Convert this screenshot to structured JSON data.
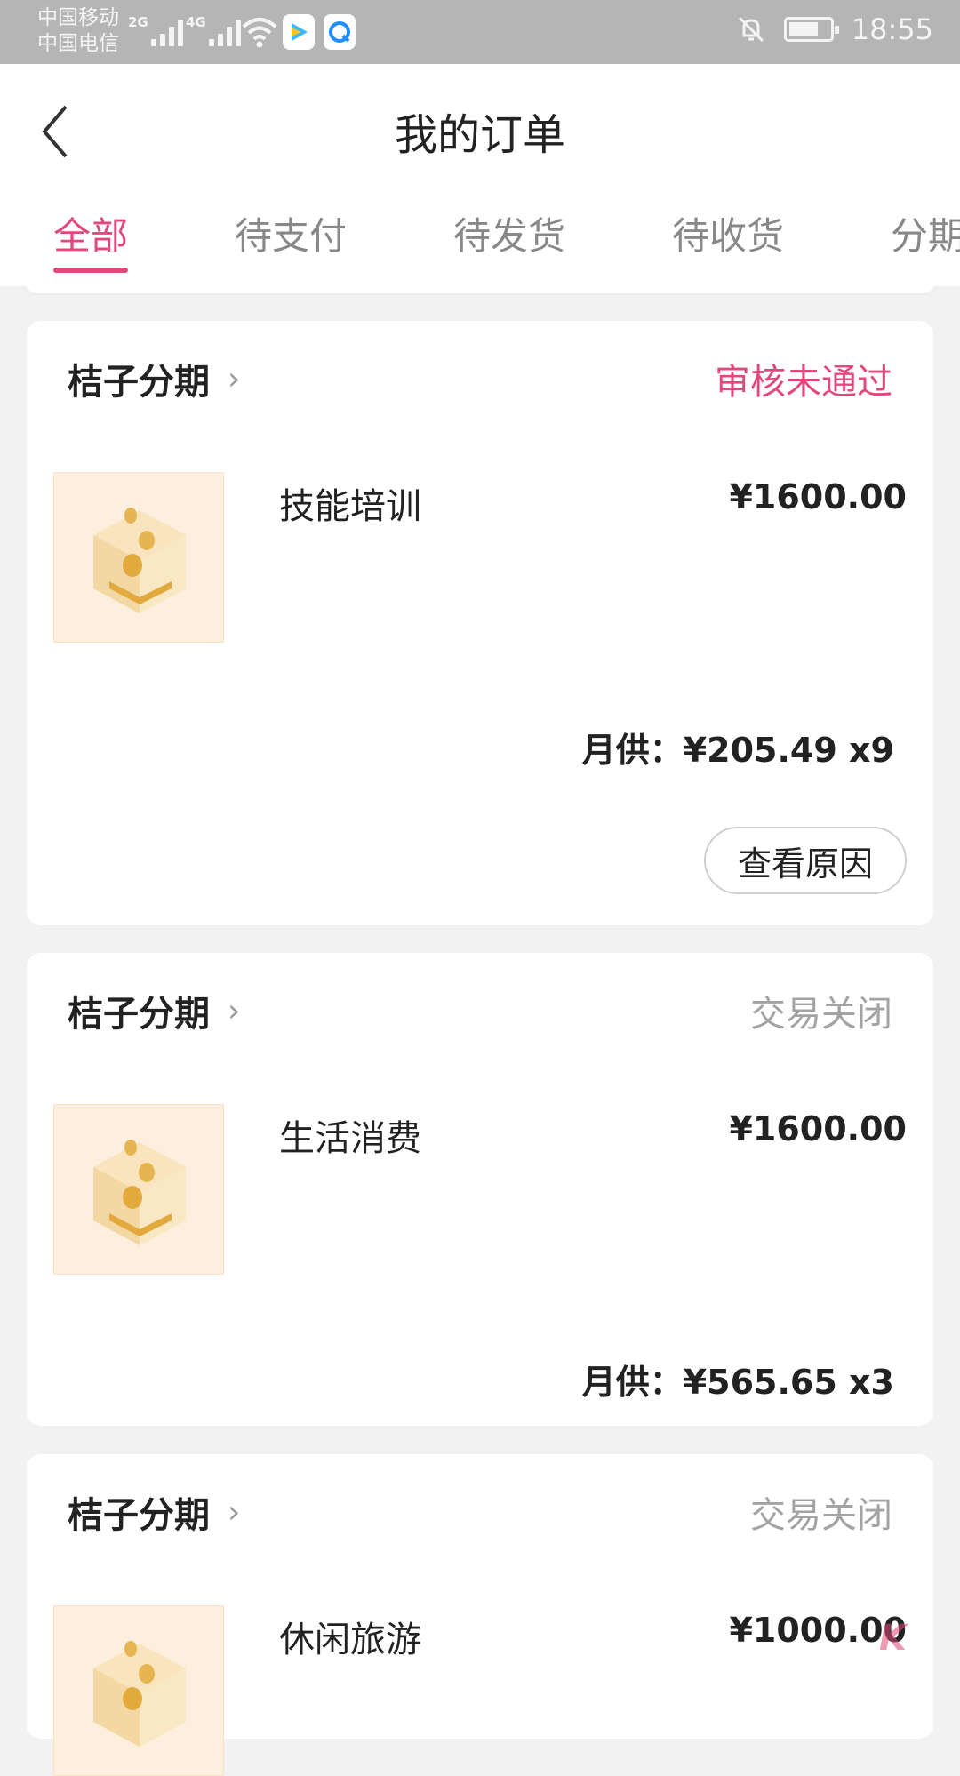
{
  "status_bar": {
    "carrier1": "中国移动",
    "carrier2": "中国电信",
    "net1": "2G",
    "net2": "4G",
    "time": "18:55",
    "icons": [
      "signal-icon",
      "wifi-icon",
      "video-app-icon",
      "browser-app-icon",
      "bell-off-icon",
      "battery-icon"
    ]
  },
  "header": {
    "title": "我的订单",
    "back_icon": "chevron-left-icon"
  },
  "tabs": [
    {
      "label": "全部",
      "active": true
    },
    {
      "label": "待支付",
      "active": false
    },
    {
      "label": "待发货",
      "active": false
    },
    {
      "label": "待收货",
      "active": false
    },
    {
      "label": "分期",
      "active": false
    }
  ],
  "orders": [
    {
      "merchant": "桔子分期",
      "status": "审核未通过",
      "status_color": "#e3487a",
      "product": "技能培训",
      "price": "¥1600.00",
      "monthly": "月供：¥205.49 x9",
      "action": "查看原因"
    },
    {
      "merchant": "桔子分期",
      "status": "交易关闭",
      "status_color": "#a3a3a3",
      "product": "生活消费",
      "price": "¥1600.00",
      "monthly": "月供：¥565.65 x3"
    },
    {
      "merchant": "桔子分期",
      "status": "交易关闭",
      "status_color": "#a3a3a3",
      "product": "休闲旅游",
      "price": "¥1000.00"
    }
  ],
  "colors": {
    "accent": "#e3487a",
    "background": "#f2f2f2"
  }
}
